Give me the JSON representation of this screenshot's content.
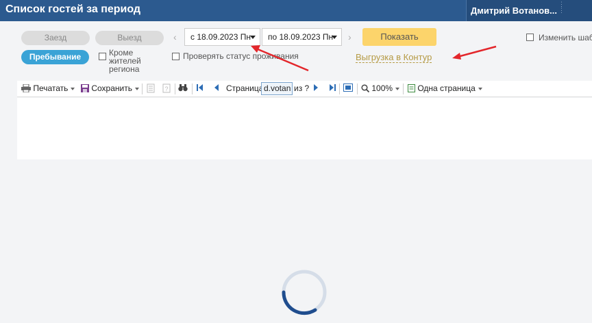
{
  "header": {
    "title": "Список гостей за период",
    "user": "Дмитрий Вотанов..."
  },
  "filters": {
    "arrival": "Заезд",
    "departure": "Выезд",
    "stay": "Пребывание",
    "except_residents": "Кроме жителей региона",
    "check_status": "Проверять статус проживания",
    "change_template": "Изменить шабл"
  },
  "dates": {
    "from": "с 18.09.2023 Пн",
    "to": "по 18.09.2023 Пн"
  },
  "actions": {
    "show": "Показать",
    "export": "Выгрузка в Контур"
  },
  "toolbar": {
    "print": "Печатать",
    "save": "Сохранить",
    "page_label": "Страница",
    "page_value": "d.votan",
    "of_label": "из ?",
    "zoom": "100%",
    "view_mode": "Одна страница"
  },
  "colors": {
    "header_bg": "#2c5a8f",
    "accent_blue": "#3aa3d6",
    "show_button": "#fcd46b",
    "export_link": "#b59a44",
    "annotation_arrow": "#e3262b"
  }
}
